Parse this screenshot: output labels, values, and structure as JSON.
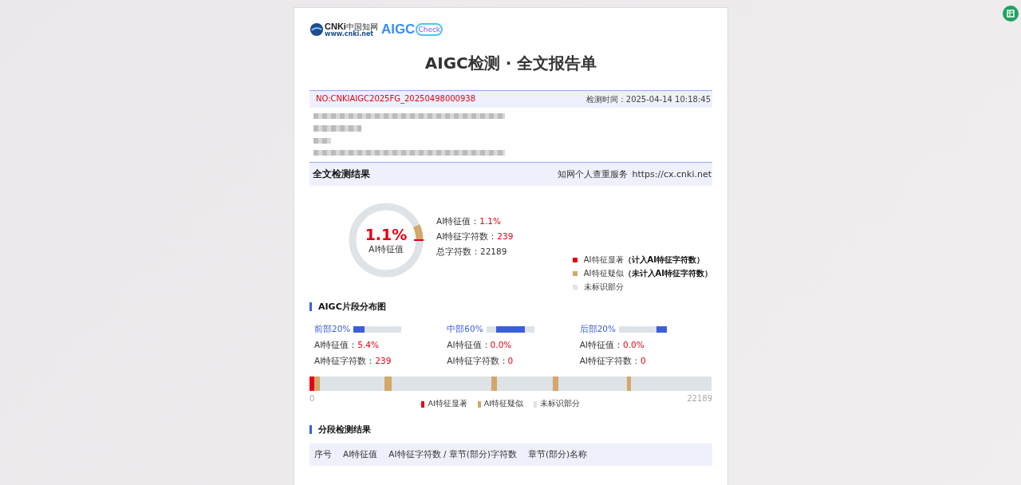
{
  "logo": {
    "cnki": "CNKi",
    "cn_name": "中国知网",
    "site": "www.cnki.net",
    "aigc": "AIGC",
    "check": "Check"
  },
  "title": "AIGC检测 · 全文报告单",
  "report_no": "NO:CNKIAIGC2025FG_20250498000938",
  "check_time": "检测时间：2025-04-14 10:18:45",
  "redacted_lines": [
    {
      "kind": "long"
    },
    {
      "kind": "short"
    },
    {
      "kind": "tiny"
    },
    {
      "kind": "long"
    }
  ],
  "result_header": {
    "title": "全文检测结果",
    "service": "知网个人查重服务",
    "url": "https://cx.cnki.net"
  },
  "donut": {
    "value": "1.1%",
    "label": "AI特征值"
  },
  "stats": [
    {
      "label": "AI特征值：",
      "value": "1.1%",
      "highlight": true
    },
    {
      "label": "AI特征字符数：",
      "value": "239",
      "highlight": true
    },
    {
      "label": "总字符数：",
      "value": "22189",
      "highlight": false
    }
  ],
  "legend": [
    {
      "label": "AI特征显著",
      "note": "（计入AI特征字符数）",
      "color": "#e60012"
    },
    {
      "label": "AI特征疑似",
      "note": "（未计入AI特征字符数）",
      "color": "#d4a76a"
    },
    {
      "label": "未标识部分",
      "color": "#dde3e7"
    }
  ],
  "distribution": {
    "title": "AIGC片段分布图",
    "parts": [
      {
        "name": "前部20%",
        "kind": "front",
        "value_label": "AI特征值：",
        "value": "5.4%",
        "count_label": "AI特征字符数：",
        "count": "239"
      },
      {
        "name": "中部60%",
        "kind": "middle",
        "value_label": "AI特征值：",
        "value": "0.0%",
        "count_label": "AI特征字符数：",
        "count": "0"
      },
      {
        "name": "后部20%",
        "kind": "back",
        "value_label": "AI特征值：",
        "value": "0.0%",
        "count_label": "AI特征字符数：",
        "count": "0"
      }
    ],
    "axis_start": "0",
    "axis_end": "22189",
    "legend": [
      {
        "label": "AI特征显著",
        "color": "#e60012"
      },
      {
        "label": "AI特征疑似",
        "color": "#d4a76a"
      },
      {
        "label": "未标识部分",
        "color": "#dde3e7"
      }
    ]
  },
  "segments": {
    "title": "分段检测结果",
    "columns": [
      "序号",
      "AI特征值",
      "AI特征字符数 / 章节(部分)字符数",
      "章节(部分)名称"
    ]
  }
}
